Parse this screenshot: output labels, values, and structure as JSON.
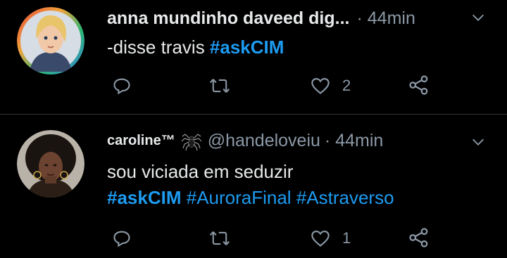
{
  "tweets": [
    {
      "author_name": "anna mundinho daveed dig...",
      "time": "· 44min",
      "text_prefix": "-disse travis ",
      "hashtags": [
        "#askCIM"
      ],
      "like_count": "2",
      "retweet_count": "",
      "icons": [
        "reply-icon",
        "retweet-icon",
        "heart-icon",
        "share-icon"
      ]
    },
    {
      "author_name": "caroline™",
      "handle": "@handeloveiu",
      "time": "· 44min",
      "text_line1": "sou viciada em seduzir",
      "hashtags": [
        "#askCIM",
        "#AuroraFinal",
        "#Astraverso"
      ],
      "like_count": "1",
      "retweet_count": "",
      "icons": [
        "reply-icon",
        "retweet-icon",
        "heart-icon",
        "share-icon",
        "spider-icon"
      ]
    }
  ],
  "colors": {
    "background": "#000000",
    "text": "#e7e9ea",
    "muted": "#8b98a5",
    "link": "#1d9bf0",
    "divider": "#2f3336"
  }
}
